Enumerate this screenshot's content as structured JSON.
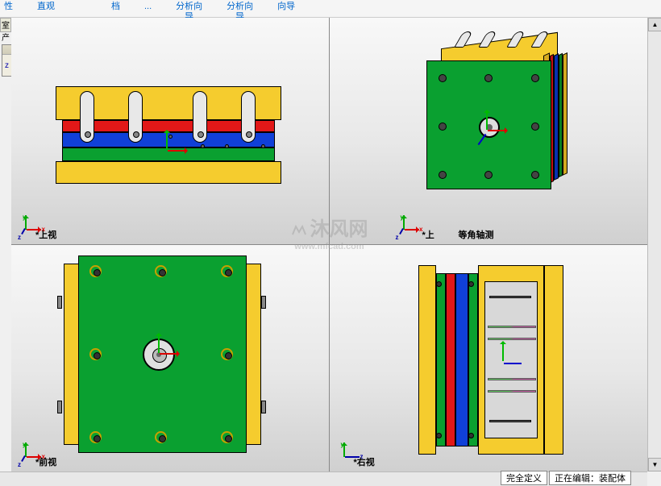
{
  "menu": {
    "items": [
      "性",
      "直观",
      "档",
      "...",
      "分析向\n导",
      "分析向\n导",
      "向导"
    ]
  },
  "left_tab": "室产品",
  "floating": {
    "z_label": "z",
    "close": "×"
  },
  "views": {
    "tl_label": "*上视",
    "tr_label1": "*上",
    "tr_label2": "等角轴测",
    "bl_label": "*前视",
    "br_label": "*右视"
  },
  "axes": {
    "x": "x",
    "y": "y",
    "z": "z"
  },
  "watermark": {
    "main": "沐风网",
    "sub": "www.mfcad.com"
  },
  "status": {
    "defined": "完全定义",
    "editing": "正在编辑：装配体"
  },
  "colors": {
    "yellow": "#f5cc2e",
    "red": "#e21818",
    "blue": "#1040d8",
    "green": "#0aa030"
  }
}
